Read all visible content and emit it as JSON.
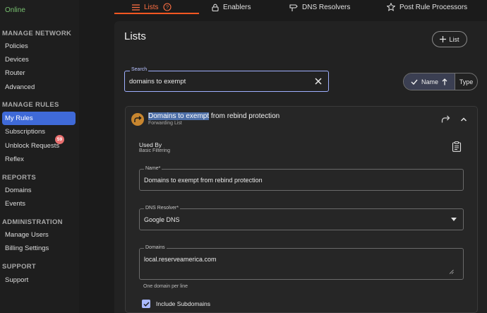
{
  "sidebar": {
    "status": "Online",
    "sections": [
      {
        "heading": "MANAGE NETWORK",
        "items": [
          "Policies",
          "Devices",
          "Router",
          "Advanced"
        ]
      },
      {
        "heading": "MANAGE RULES",
        "items": [
          "My Rules",
          "Subscriptions",
          "Unblock Requests",
          "Reflex"
        ]
      },
      {
        "heading": "REPORTS",
        "items": [
          "Domains",
          "Events"
        ]
      },
      {
        "heading": "ADMINISTRATION",
        "items": [
          "Manage Users",
          "Billing Settings"
        ]
      },
      {
        "heading": "SUPPORT",
        "items": [
          "Support"
        ]
      }
    ],
    "active_item": "My Rules",
    "unblock_badge": "59"
  },
  "tabs": [
    {
      "label": "Lists",
      "icon": "list-icon",
      "active": true
    },
    {
      "label": "Enablers",
      "icon": "lock-icon"
    },
    {
      "label": "DNS Resolvers",
      "icon": "signpost-icon"
    },
    {
      "label": "Post Rule Processors",
      "icon": "star-icon"
    }
  ],
  "page": {
    "title": "Lists",
    "add_button": "List"
  },
  "search": {
    "label": "Search",
    "value": "domains to exempt"
  },
  "sort": {
    "name_label": "Name",
    "type_label": "Type"
  },
  "card": {
    "title_highlight": "Domains to exempt",
    "title_rest": " from rebind protection",
    "subtitle": "Forwarding List",
    "used_by_heading": "Used By",
    "used_by_value": "Basic Filtering",
    "name_label": "Name*",
    "name_value": "Domains to exempt from rebind protection",
    "resolver_label": "DNS Resolver*",
    "resolver_value": "Google DNS",
    "domains_label": "Domains",
    "domains_value": "local.reserveamerica.com",
    "domains_helper": "One domain per line",
    "include_subdomains_label": "Include Subdomains",
    "include_subdomains_checked": true
  },
  "colors": {
    "accent": "#ff5722",
    "active_nav": "#3f6ad8",
    "badge": "#e86f6f",
    "avatar": "#c8862f"
  }
}
